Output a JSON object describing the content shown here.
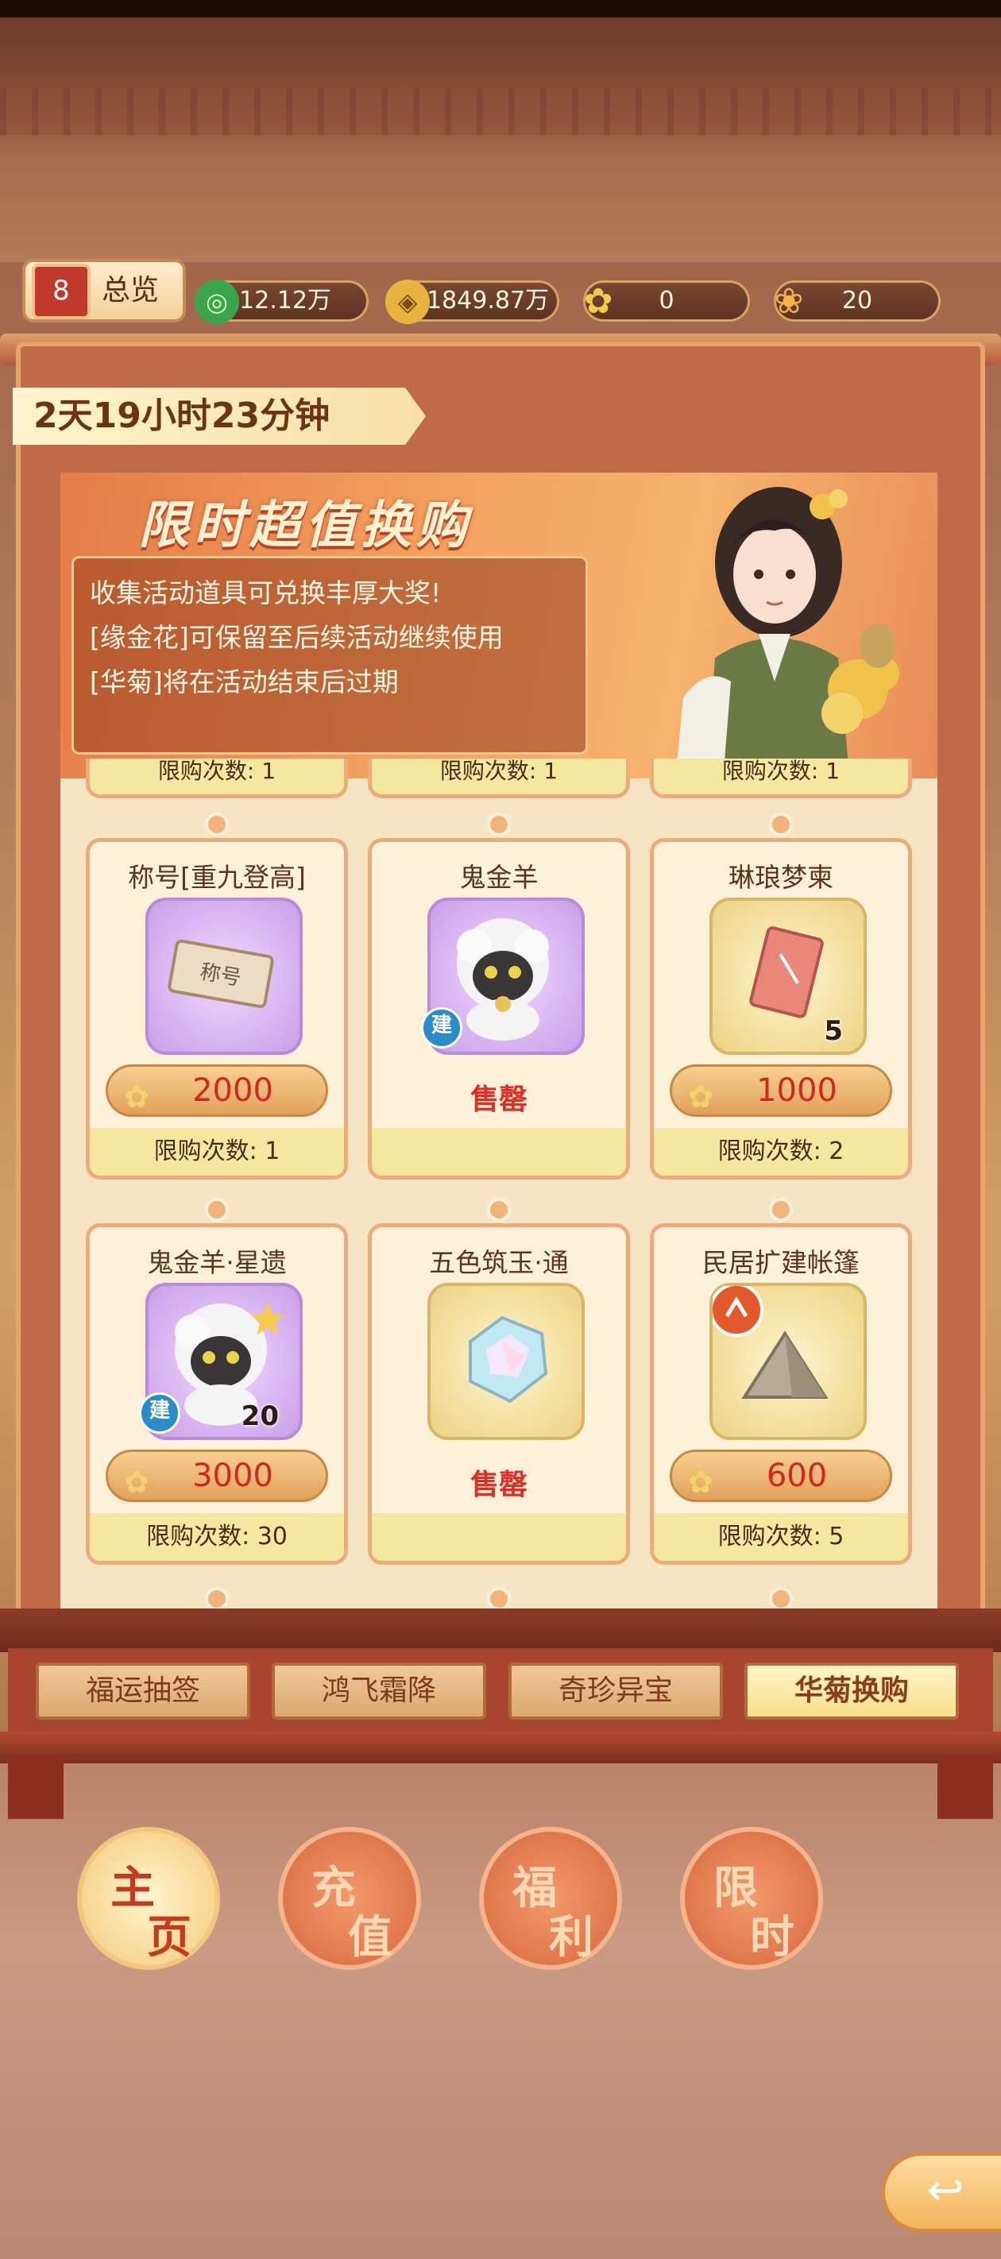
{
  "header": {
    "overview_label": "总览",
    "overview_icon_text": "8",
    "resources": [
      {
        "icon": "jade-coin-icon",
        "value": "12.12万"
      },
      {
        "icon": "gold-coin-icon",
        "value": "1849.87万"
      },
      {
        "icon": "golden-flower-icon",
        "value": "0"
      },
      {
        "icon": "chrysanthemum-icon",
        "value": "20"
      }
    ]
  },
  "timer": "2天19小时23分钟",
  "banner": {
    "title": "限时超值换购",
    "lines": [
      "收集活动道具可兑换丰厚大奖!",
      "[缘金花]可保留至后续活动继续使用",
      "[华菊]将在活动结束后过期"
    ]
  },
  "top_stub_label": "限购次数: 1",
  "items": [
    {
      "name": "称号[重九登高]",
      "price": "2000",
      "limit": "限购次数: 1",
      "status": ""
    },
    {
      "name": "鬼金羊",
      "price": "",
      "limit": "",
      "status": "售罄",
      "badge": "建"
    },
    {
      "name": "琳琅梦柬",
      "price": "1000",
      "limit": "限购次数: 2",
      "status": "",
      "qty": "5"
    },
    {
      "name": "鬼金羊·星遗",
      "price": "3000",
      "limit": "限购次数: 30",
      "status": "",
      "qty": "20",
      "badge": "建"
    },
    {
      "name": "五色筑玉·通",
      "price": "",
      "limit": "",
      "status": "售罄"
    },
    {
      "name": "民居扩建帐篷",
      "price": "600",
      "limit": "限购次数: 5",
      "status": ""
    }
  ],
  "tabs": [
    "福运抽签",
    "鸿飞霜降",
    "奇珍异宝",
    "华菊换购"
  ],
  "active_tab": "华菊换购",
  "nav": [
    {
      "c1": "主",
      "c2": "页",
      "active": true
    },
    {
      "c1": "充",
      "c2": "值",
      "active": false
    },
    {
      "c1": "福",
      "c2": "利",
      "active": false
    },
    {
      "c1": "限",
      "c2": "时",
      "active": false
    }
  ],
  "back_icon": "back-arrow-icon",
  "colors": {
    "price_red": "#d2261f",
    "soldout_red": "#e02e26",
    "accent_gold": "#f4c877"
  }
}
